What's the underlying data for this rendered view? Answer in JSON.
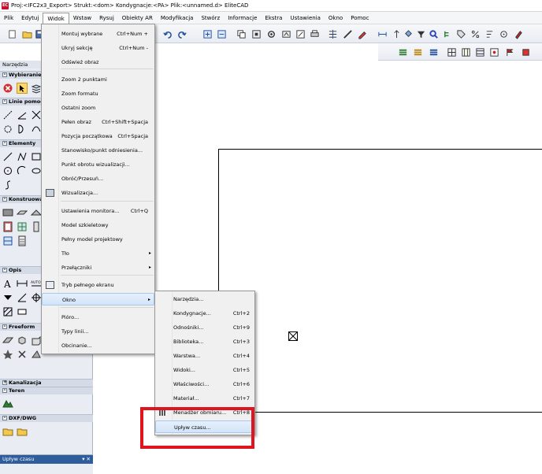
{
  "window": {
    "title": "Proj:<IFC2x3_Export> Strukt:<dom> Kondygnacje:<PA> Plik:<unnamed.d> EliteCAD",
    "app_icon_text": "EC"
  },
  "menubar": {
    "items": [
      "Plik",
      "Edytuj",
      "Widok",
      "Wstaw",
      "Rysuj",
      "Obiekty AR",
      "Modyfikacja",
      "Stwórz",
      "Informacje",
      "Ekstra",
      "Ustawienia",
      "Okno",
      "Pomoc"
    ],
    "active": "Widok"
  },
  "left_panel": {
    "title": "Narzędzia",
    "sections": [
      "Wybieranie",
      "Linie pomocnicze",
      "Elementy",
      "Konstruowanie",
      "Opis",
      "Freeform",
      "Kanalizacja",
      "Teren",
      "DXF/DWG"
    ]
  },
  "time_panel": {
    "title": "Upływ czasu",
    "controls": "▾ ✕"
  },
  "widok_menu": {
    "items": [
      {
        "label": "Montuj wybrane",
        "shortcut": "Ctrl+Num +"
      },
      {
        "label": "Ukryj sekcję",
        "shortcut": "Ctrl+Num -"
      },
      {
        "label": "Odśwież obraz",
        "shortcut": ""
      },
      {
        "label": "Zoom 2 punktami",
        "shortcut": ""
      },
      {
        "label": "Zoom formatu",
        "shortcut": ""
      },
      {
        "label": "Ostatni zoom",
        "shortcut": ""
      },
      {
        "label": "Pełen obraz",
        "shortcut": "Ctrl+Shift+Spacja"
      },
      {
        "label": "Pozycja początkowa",
        "shortcut": "Ctrl+Spacja"
      },
      {
        "label": "Stanowisko/punkt odniesienia...",
        "shortcut": ""
      },
      {
        "label": "Punkt obrotu wizualizacji...",
        "shortcut": ""
      },
      {
        "label": "Obróć/Przesuń...",
        "shortcut": ""
      },
      {
        "label": "Wizualizacja...",
        "shortcut": ""
      },
      {
        "label": "Ustawienia monitora...",
        "shortcut": "Ctrl+Q"
      },
      {
        "label": "Model szkieletowy",
        "shortcut": ""
      },
      {
        "label": "Pełny model projektowy",
        "shortcut": ""
      },
      {
        "label": "Tło",
        "shortcut": ""
      },
      {
        "label": "Przełączniki",
        "shortcut": ""
      },
      {
        "label": "Tryb pełnego ekranu",
        "shortcut": ""
      },
      {
        "label": "Okno",
        "shortcut": ""
      },
      {
        "label": "Pióro...",
        "shortcut": ""
      },
      {
        "label": "Typy linii...",
        "shortcut": ""
      },
      {
        "label": "Obcinanie...",
        "shortcut": ""
      }
    ]
  },
  "okno_submenu": {
    "items": [
      {
        "label": "Narzędzia...",
        "shortcut": ""
      },
      {
        "label": "Kondygnacje...",
        "shortcut": "Ctrl+2"
      },
      {
        "label": "Odnośniki...",
        "shortcut": "Ctrl+9"
      },
      {
        "label": "Biblioteka...",
        "shortcut": "Ctrl+3"
      },
      {
        "label": "Warstwa...",
        "shortcut": "Ctrl+4"
      },
      {
        "label": "Widoki...",
        "shortcut": "Ctrl+5"
      },
      {
        "label": "Właściwości...",
        "shortcut": "Ctrl+6"
      },
      {
        "label": "Materiał...",
        "shortcut": "Ctrl+7"
      },
      {
        "label": "Menadżer obmiaru...",
        "shortcut": "Ctrl+8"
      },
      {
        "label": "Upływ czasu...",
        "shortcut": ""
      }
    ]
  },
  "colors": {
    "highlight_box": "#e0141e",
    "panel_bg": "#e9edf3",
    "menu_highlight": "#d3e4f8"
  }
}
